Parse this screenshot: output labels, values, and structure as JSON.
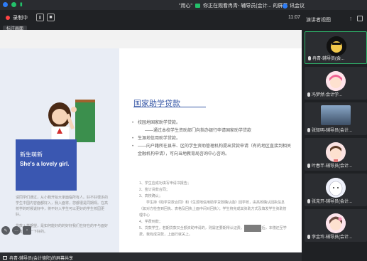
{
  "topbar": {
    "status_icons": [
      "blue-shield-icon",
      "green-check-icon",
      "signal-icon"
    ],
    "sharing_user": "\"用心\"",
    "watching_text": "你正在观看冉青- 辅导员(会计... 的屏幕",
    "meeting_label": "讯会议"
  },
  "controls": {
    "recording_label": "录制中",
    "pause_icon": "Ⅱ",
    "stop_icon": "■",
    "mark_label": "标注画面",
    "time": "11:07"
  },
  "gallery_head": {
    "view_label": "演讲者视图",
    "more": "⁝"
  },
  "slide": {
    "left_blue_line1": "新生萌新",
    "left_blue_line2": "She's a lovely girl.",
    "left_paragraph": "请同学们通过，从小我开始大家面临所有人。好不好很多的学生中国内容面都好入，我入面将，您都很是同期现。在高校学的时候说好中，将不好入学生可以更好的学生校园更好。\n\n贷款入学期望，是如何能好的的好好我们在好在的平与面好入有，对一下好的。",
    "title": "国家助学贷款",
    "bullet1": "校园地国家助学贷款。",
    "bullet1_sub": "——通过本校学生资助部门向指办银行申请国家助学贷款",
    "bullet2": "生源地信用助学贷款。",
    "bullet3": "——向户籍所在县市、区的学生资助管理机构提出贷款申请（有的地区直接到相关金融机构申请），可向当地教育局咨询中心咨询。",
    "numbered": [
      "1、学生应成功填写申请书报告；",
      "2、签订贷款合同；",
      "3、高校确认；",
      "　　学生持《助学贷款合同》和《生源地信用助学贷款确认函》回学校，由高校确认回执信息（如对方检查到回执、表格及回执上面中间对回执）；学生将完成其资助方式及填发学生资助管理中心",
      "4、学费到款；",
      "5、贷款学生，若期贷款又全额资助申请的，则需还要期得认证费。若贷款毕业后，本偿还至学费，我有成贷款，上面行就关上。"
    ]
  },
  "stage_tools": [
    "pen-icon",
    "chat-icon",
    "collapse-icon"
  ],
  "gallery": {
    "tiles": [
      {
        "name": "冉青-辅导员(会...",
        "kind": "avatar",
        "accent": "#f2c94c"
      },
      {
        "name": "冯梦然-会计学...",
        "kind": "avatar",
        "accent": "#f06292"
      },
      {
        "name": "张知明-辅导员(会计...",
        "kind": "camera",
        "accent": "#6b8fb5"
      },
      {
        "name": "叶春芊-辅导员(会计...",
        "kind": "avatar",
        "accent": "#e57373"
      },
      {
        "name": "张克开-辅导员(会计...",
        "kind": "avatar",
        "accent": "#c5cae9"
      },
      {
        "name": "李金玲-辅导员(会计...",
        "kind": "avatar",
        "accent": "#f48fb1"
      }
    ]
  },
  "share_bar": {
    "text": "冉青-辅导员(会计德阳)的屏幕共享"
  }
}
